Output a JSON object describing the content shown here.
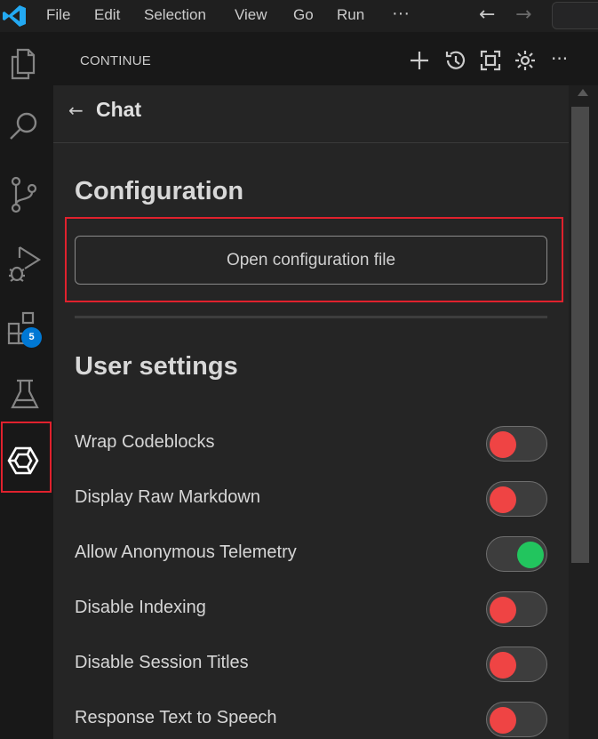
{
  "titlebar": {
    "menu": [
      "File",
      "Edit",
      "Selection",
      "View",
      "Go",
      "Run"
    ],
    "more": "···",
    "back_arrow": "←",
    "forward_arrow": "→"
  },
  "activity_bar": {
    "items": [
      "explorer-icon",
      "search-icon",
      "source-control-icon",
      "run-debug-icon",
      "extensions-icon",
      "testing-icon",
      "continue-icon"
    ],
    "extensions_badge": "5",
    "active_item": "continue-icon"
  },
  "panel": {
    "title": "CONTINUE",
    "header_icons": [
      "plus-icon",
      "history-icon",
      "fullscreen-icon",
      "gear-icon",
      "more-icon"
    ],
    "more": "···"
  },
  "chat": {
    "back_icon": "←",
    "title": "Chat"
  },
  "configuration": {
    "heading": "Configuration",
    "open_button": "Open configuration file"
  },
  "user_settings": {
    "heading": "User settings",
    "items": [
      {
        "label": "Wrap Codeblocks",
        "enabled": false
      },
      {
        "label": "Display Raw Markdown",
        "enabled": false
      },
      {
        "label": "Allow Anonymous Telemetry",
        "enabled": true
      },
      {
        "label": "Disable Indexing",
        "enabled": false
      },
      {
        "label": "Disable Session Titles",
        "enabled": false
      },
      {
        "label": "Response Text to Speech",
        "enabled": false
      }
    ]
  },
  "colors": {
    "toggle_off": "#ef4444",
    "toggle_on": "#22c55e",
    "highlight": "#e0212d",
    "badge": "#0078d4",
    "vscode_blue": "#23a9f2"
  }
}
